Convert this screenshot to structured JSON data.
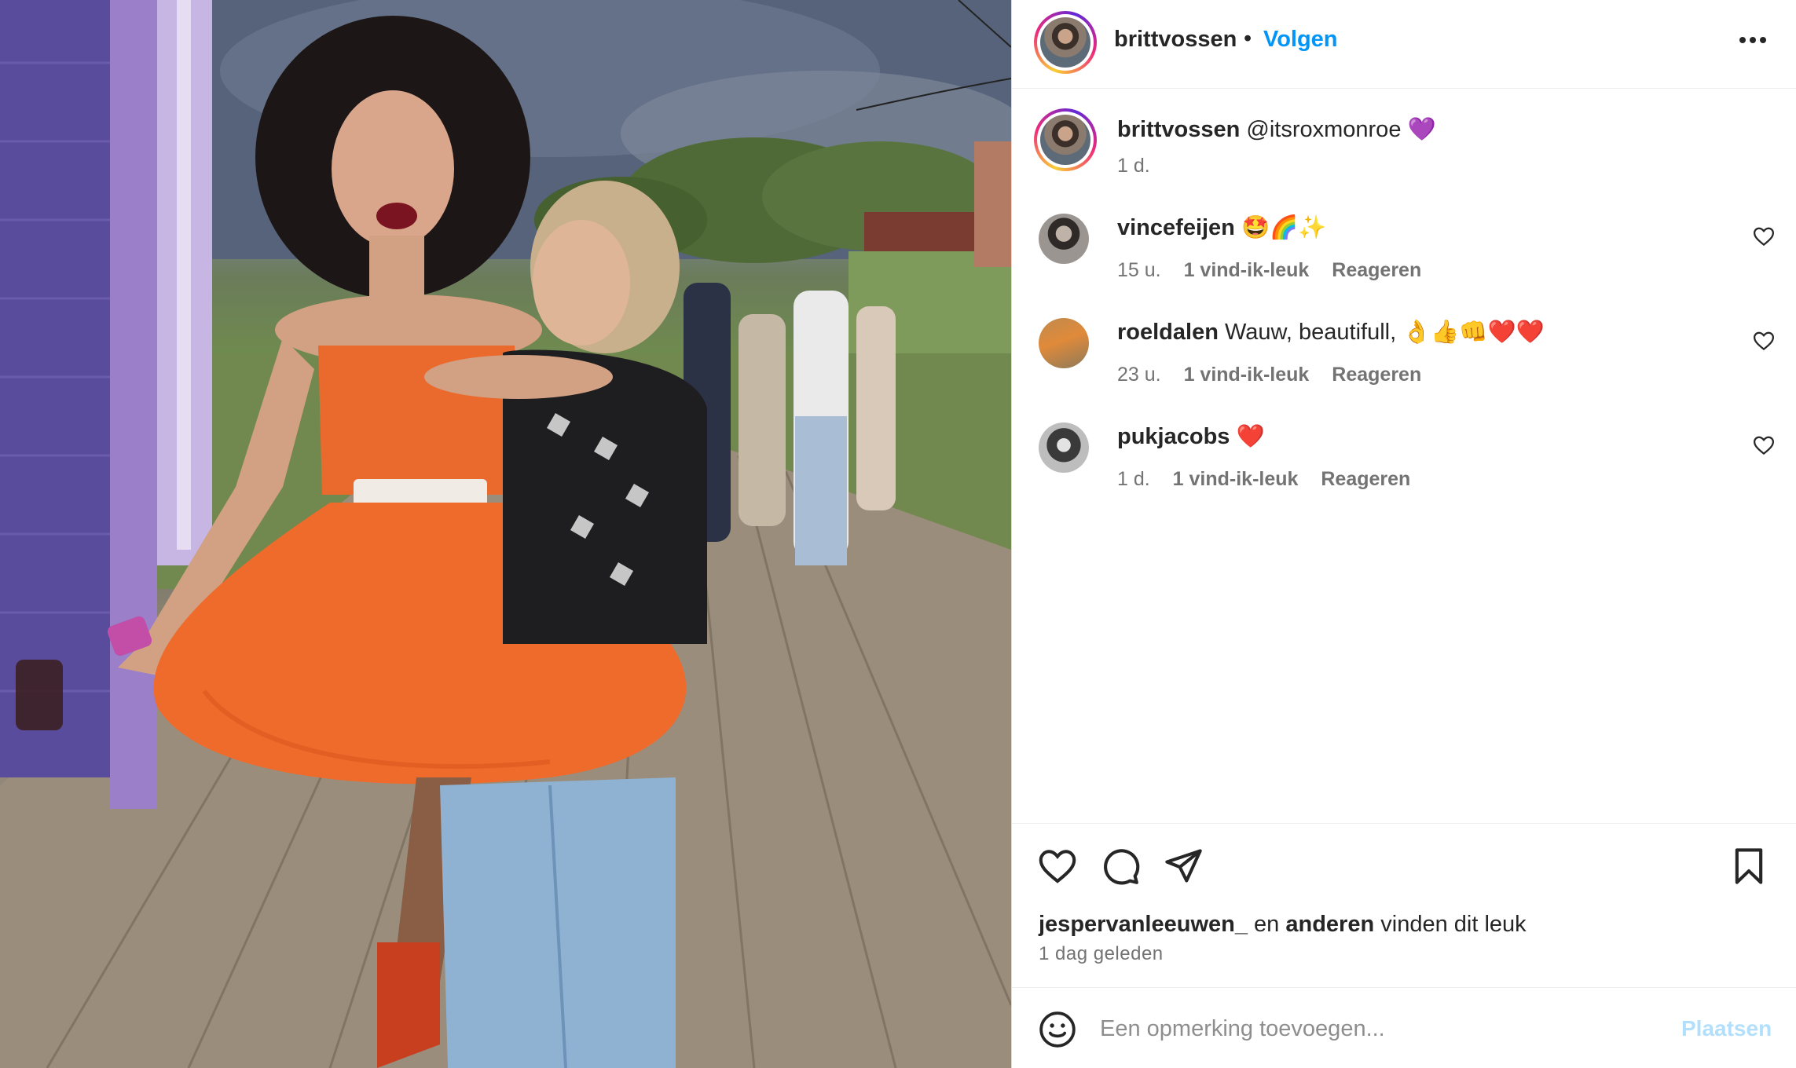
{
  "post": {
    "image_alt": "Photo of two people posing together at an outdoor festival"
  },
  "header": {
    "username": "brittvossen",
    "separator": "•",
    "follow_label": "Volgen",
    "more_icon": "more-horizontal-icon"
  },
  "caption": {
    "username": "brittvossen",
    "text": "@itsroxmonroe 💜",
    "time": "1 d."
  },
  "comments": [
    {
      "username": "vincefeijen",
      "text": "🤩🌈✨",
      "time": "15 u.",
      "likes": "1 vind-ik-leuk",
      "reply": "Reageren"
    },
    {
      "username": "roeldalen",
      "text": "Wauw, beautifull, 👌👍👊❤️❤️",
      "time": "23 u.",
      "likes": "1 vind-ik-leuk",
      "reply": "Reageren"
    },
    {
      "username": "pukjacobs",
      "text": "❤️",
      "time": "1 d.",
      "likes": "1 vind-ik-leuk",
      "reply": "Reageren"
    }
  ],
  "actions": {
    "liked_by_user": "jespervanleeuwen_",
    "liked_and": "en",
    "liked_others": "anderen",
    "liked_suffix": "vinden dit leuk",
    "posted_ago": "1 dag geleden"
  },
  "add_comment": {
    "placeholder": "Een opmerking toevoegen...",
    "post_label": "Plaatsen",
    "post_color": "#b2dffc"
  },
  "colors": {
    "link": "#0095f6",
    "text": "#262626",
    "muted": "#737373"
  }
}
